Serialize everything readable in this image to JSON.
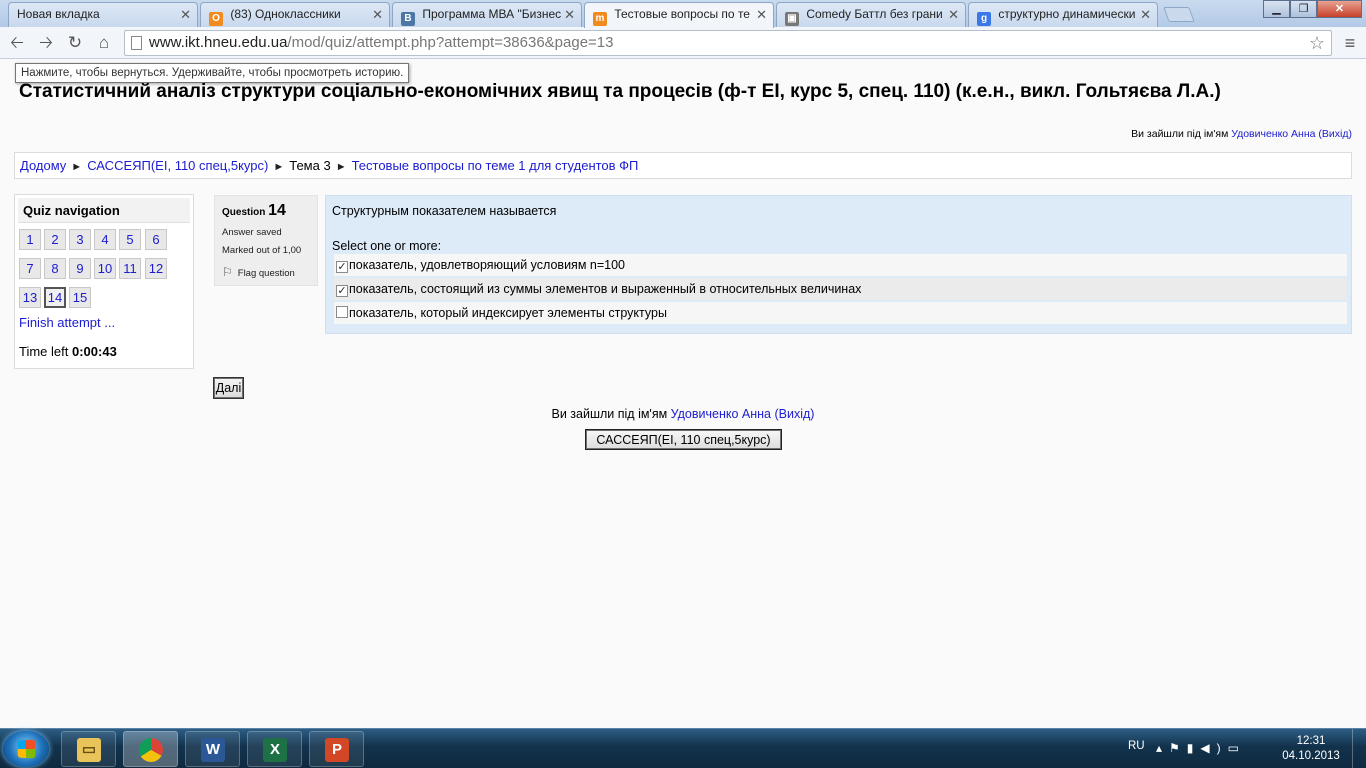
{
  "browser": {
    "tabs": [
      {
        "title": "Новая вкладка",
        "icon": "blank-page-icon",
        "icon_color": ""
      },
      {
        "title": "(83) Одноклассники",
        "icon": "odnoklassniki-icon",
        "icon_color": "#f28c1f"
      },
      {
        "title": "Программа МВА \"Бизнес",
        "icon": "vk-icon",
        "icon_color": "#4d77a5"
      },
      {
        "title": "Тестовые вопросы по те",
        "icon": "moodle-icon",
        "icon_color": "#f18b21"
      },
      {
        "title": "Comedy Баттл без грани",
        "icon": "film-icon",
        "icon_color": "#777777"
      },
      {
        "title": "структурно динамически",
        "icon": "google-icon",
        "icon_color": "#3b78e7"
      }
    ],
    "url_host": "www.ikt.hneu.edu.ua",
    "url_path": "/mod/quiz/attempt.php?attempt=38636&page=13",
    "tooltip": "Нажмите, чтобы вернуться. Удерживайте, чтобы просмотреть историю."
  },
  "page": {
    "title": "Статистичний аналіз структури соціально-економічних явищ та процесів (ф-т ЕІ, курс 5, спец. 110) (к.е.н., викл. Гольтяєва Л.А.)",
    "login_prefix": "Ви зайшли під ім'ям",
    "user_name": "Удовиченко Анна",
    "logout": "(Вихід)",
    "breadcrumb": {
      "home": "Додому",
      "course": "САССЕЯП(ЕІ, 110 спец,5курс)",
      "section": "Тема 3",
      "quiz": "Тестовые вопросы по теме 1 для студентов ФП",
      "separator": "►"
    }
  },
  "quiz_nav": {
    "header": "Quiz navigation",
    "questions": [
      "1",
      "2",
      "3",
      "4",
      "5",
      "6",
      "7",
      "8",
      "9",
      "10",
      "11",
      "12",
      "13",
      "14",
      "15"
    ],
    "current": "14",
    "finish": "Finish attempt ...",
    "time_label": "Time left",
    "time_value": "0:00:43"
  },
  "question": {
    "label": "Question",
    "number": "14",
    "state": "Answer saved",
    "grade": "Marked out of 1,00",
    "flag": "Flag question",
    "text": "Структурным показателем называется",
    "prompt": "Select one or more:",
    "answers": [
      {
        "text": "показатель, удовлетворяющий условиям n=100",
        "checked": true
      },
      {
        "text": "показатель, состоящий из суммы элементов и выраженный в относительных величинах",
        "checked": true
      },
      {
        "text": "показатель, который индексирует элементы структуры",
        "checked": false
      }
    ]
  },
  "buttons": {
    "next": "Далі",
    "course": "САССЕЯП(ЕІ, 110 спец,5курс)"
  },
  "taskbar": {
    "lang": "RU",
    "time": "12:31",
    "date": "04.10.2013",
    "apps": [
      "explorer-icon",
      "chrome-icon",
      "word-icon",
      "excel-icon",
      "powerpoint-icon"
    ]
  }
}
